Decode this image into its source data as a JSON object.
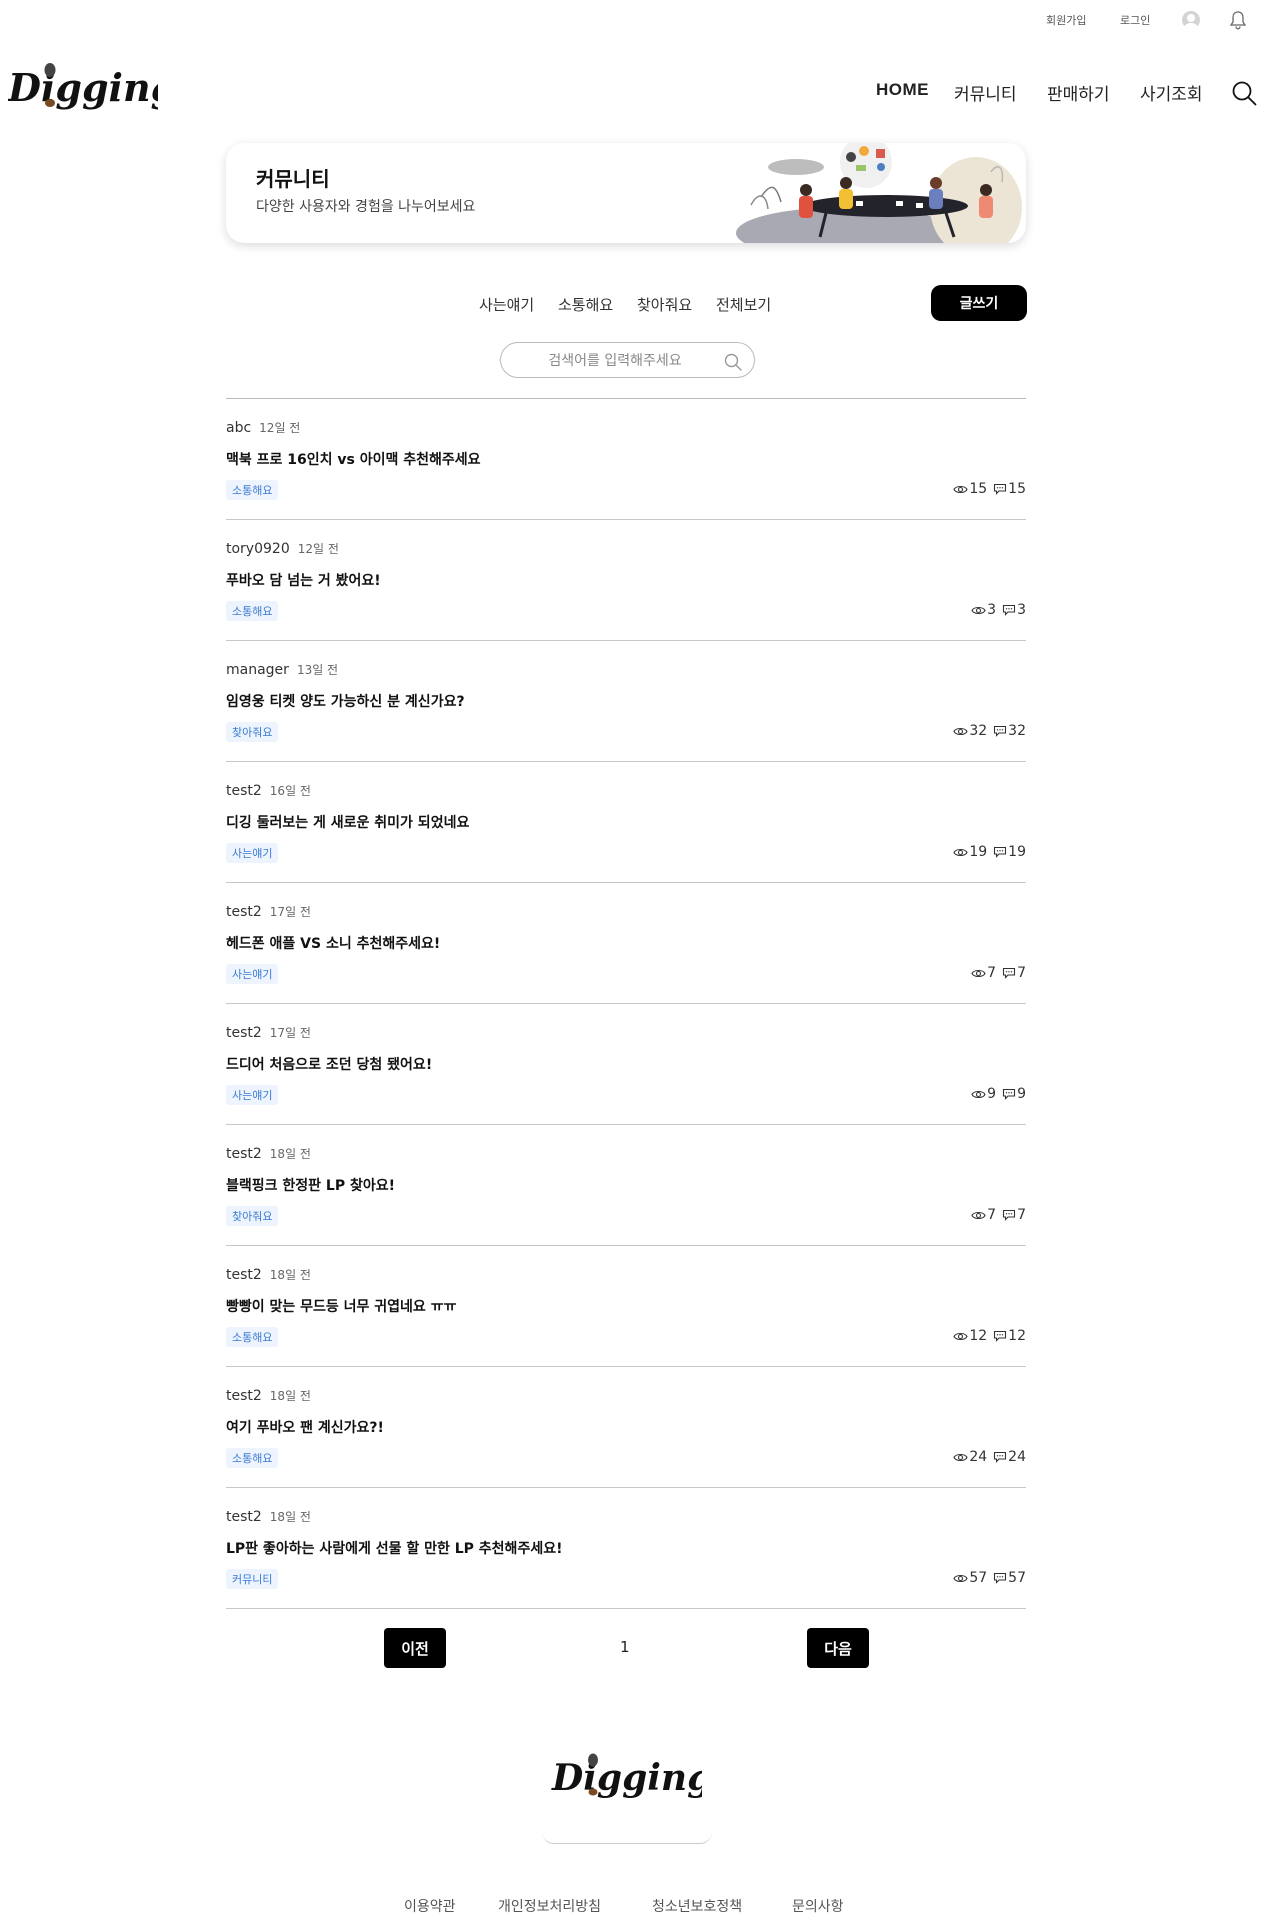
{
  "util": {
    "signup": "회원가입",
    "login": "로그인"
  },
  "logo": {
    "text": "Digging"
  },
  "nav": {
    "home": "HOME",
    "community": "커뮤니티",
    "sell": "판매하기",
    "fraud_check": "사기조회"
  },
  "banner": {
    "title": "커뮤니티",
    "subtitle": "다양한 사용자와 경험을 나누어보세요"
  },
  "tabs": [
    "사는얘기",
    "소통해요",
    "찾아줘요",
    "전체보기"
  ],
  "write_button": "글쓰기",
  "search": {
    "placeholder": "검색어를 입력해주세요",
    "value": ""
  },
  "posts": [
    {
      "author": "abc",
      "time": "12일 전",
      "title": "맥북 프로 16인치 vs 아이맥 추천해주세요",
      "tag": "소통해요",
      "views": "15",
      "comments": "15"
    },
    {
      "author": "tory0920",
      "time": "12일 전",
      "title": "푸바오 담 넘는 거 봤어요!",
      "tag": "소통해요",
      "views": "3",
      "comments": "3"
    },
    {
      "author": "manager",
      "time": "13일 전",
      "title": "임영웅 티켓 양도 가능하신 분 계신가요?",
      "tag": "찾아줘요",
      "views": "32",
      "comments": "32"
    },
    {
      "author": "test2",
      "time": "16일 전",
      "title": "디깅 둘러보는 게 새로운 취미가 되었네요",
      "tag": "사는얘기",
      "views": "19",
      "comments": "19"
    },
    {
      "author": "test2",
      "time": "17일 전",
      "title": "헤드폰 애플 VS 소니 추천해주세요!",
      "tag": "사는얘기",
      "views": "7",
      "comments": "7"
    },
    {
      "author": "test2",
      "time": "17일 전",
      "title": "드디어 처음으로 조던 당첨 됐어요!",
      "tag": "사는얘기",
      "views": "9",
      "comments": "9"
    },
    {
      "author": "test2",
      "time": "18일 전",
      "title": "블랙핑크 한정판 LP 찾아요!",
      "tag": "찾아줘요",
      "views": "7",
      "comments": "7"
    },
    {
      "author": "test2",
      "time": "18일 전",
      "title": "빵빵이 맞는 무드등 너무 귀엽네요 ㅠㅠ",
      "tag": "소통해요",
      "views": "12",
      "comments": "12"
    },
    {
      "author": "test2",
      "time": "18일 전",
      "title": "여기 푸바오 팬 계신가요?!",
      "tag": "소통해요",
      "views": "24",
      "comments": "24"
    },
    {
      "author": "test2",
      "time": "18일 전",
      "title": "LP판 좋아하는 사람에게 선물 할 만한 LP 추천해주세요!",
      "tag": "커뮤니티",
      "views": "57",
      "comments": "57"
    }
  ],
  "pagination": {
    "prev": "이전",
    "current": "1",
    "next": "다음"
  },
  "footer": {
    "links": [
      "이용약관",
      "개인정보처리방침",
      "청소년보호정책",
      "문의사항"
    ]
  },
  "colors": {
    "tag_text": "#3a7bd5",
    "tag_bg": "#eef4fd",
    "button_bg": "#000000"
  }
}
